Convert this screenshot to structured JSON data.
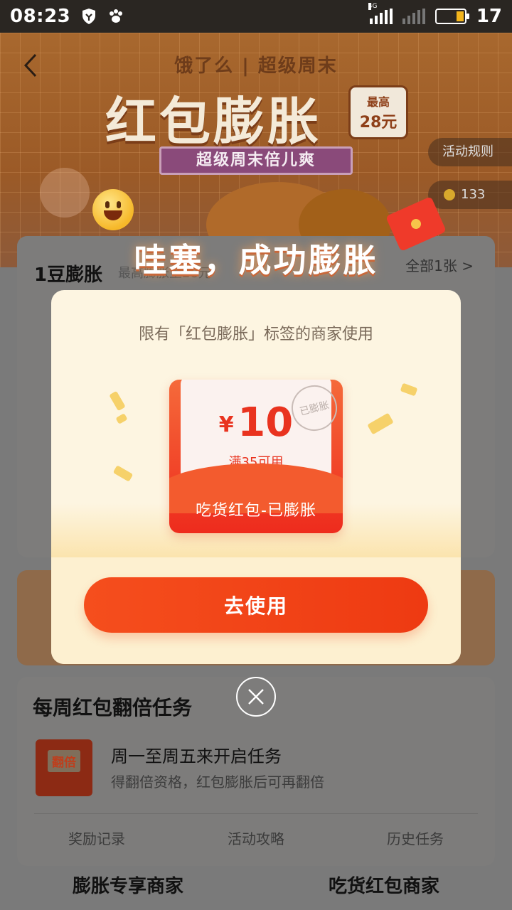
{
  "status_bar": {
    "time": "08:23",
    "network_tag": "4G",
    "battery_level": "17",
    "icons": [
      "shield-icon",
      "paw-icon",
      "signal-icon",
      "battery-icon"
    ]
  },
  "hero": {
    "brand": "饿了么 | 超级周末",
    "title": "红包膨胀",
    "max_label_line1": "最高",
    "max_label_line2": "28元",
    "subtitle": "超级周末倍儿爽",
    "rules_label": "活动规则",
    "coin_count": "133"
  },
  "coupon_card": {
    "title": "1豆膨胀",
    "subtitle": "最高膨胀至28元",
    "all_link": "全部1张 >"
  },
  "popup": {
    "headline": "哇塞，成功膨胀",
    "hint": "限有「红包膨胀」标签的商家使用",
    "stamp": "已膨胀",
    "currency": "¥",
    "amount": "10",
    "condition": "满35可用",
    "coupon_name": "吃货红包-已膨胀",
    "use_button": "去使用"
  },
  "tasks": {
    "title": "每周红包翻倍任务",
    "icon_tag": "翻倍",
    "main": "周一至周五来开启任务",
    "desc": "得翻倍资格，红包膨胀后可再翻倍",
    "links": [
      "奖励记录",
      "活动攻略",
      "历史任务"
    ]
  },
  "bottom_tabs": [
    "膨胀专享商家",
    "吃货红包商家"
  ],
  "colors": {
    "accent": "#ee3a12",
    "coupon_red": "#ee2b1d",
    "modal_bg": "#fdf5e1"
  }
}
